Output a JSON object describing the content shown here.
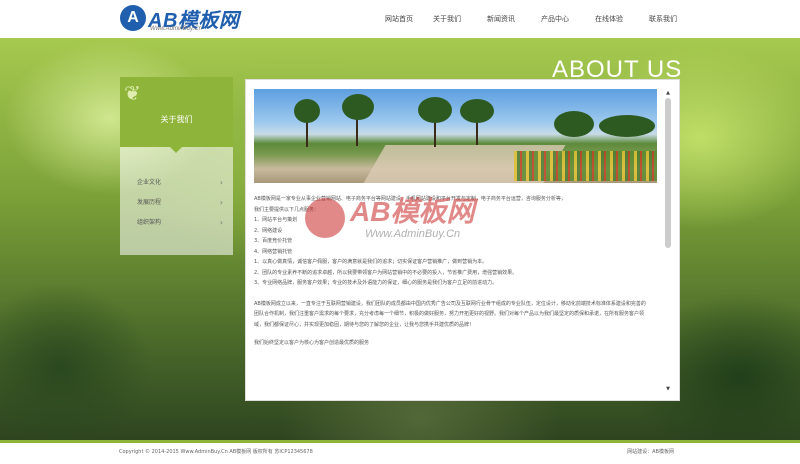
{
  "header": {
    "logo_text": "AB模板网",
    "logo_sub": "Www.AdminBuy.Cn",
    "nav": [
      "网站首页",
      "关于我们",
      "新闻资讯",
      "产品中心",
      "在线体验",
      "联系我们"
    ]
  },
  "banner": {
    "title": "ABOUT US"
  },
  "sidebar": {
    "title": "关于我们",
    "items": [
      {
        "label": "企业文化"
      },
      {
        "label": "发展历程"
      },
      {
        "label": "组织架构"
      }
    ]
  },
  "content": {
    "paragraphs": [
      "AB模板网是一家专业从事企业营销网站、电子商务平台等网站建设、手机网站建设和平台开发与定制，电子商务平台运营，咨询服务分析等，",
      "我们主要提供以下几点服务：",
      "1、网站平台与策划",
      "2、网络建设",
      "3、百度竞价托管",
      "4、网络营销托管",
      "1、以真心做真情，诚信客户佩服，客户的满意就是我们的追求；切实保证客户营销推广，做到营销为本。",
      "2、团队的专业素养不断的追求卓越，所以我要带领客户为网站营销中的不必要的投入，节省推广费用，增强营销效果。",
      "3、专业网络品牌，服务客户效果；专业的技术及外语能力的保证，细心的服务是我们为客户立足的前进动力。"
    ],
    "paragraphs_b": [
      "AB模板网成立以来，一直专注于互联网营销建设，我们团队的成员都由中国内优秀广告公司及互联网行业骨干组成的专业队伍，定位设计，移动化前端技术标准体系建设和完善的团队合作机制，我们注重客户需求的每个要求，充分考虑每一个细节，积极的做好服务，努力开拓更好的视野。我们对每个产品以为我们最坚定的质保和承诺，在所有服务客户领域，我们都保证尽心，并实现更加稳固，期待与您的了解您的企业，让我与您携手共建优质的品牌！"
    ],
    "paragraphs_c": [
      "我们始终坚定以客户为核心为客户创造最优质的服务"
    ]
  },
  "watermark": {
    "text": "AB模板网",
    "sub": "Www.AdminBuy.Cn"
  },
  "footer": {
    "copyright": "Copyright © 2014-2015 Www.AdminBuy.Cn AB模板网  版权所有  苏ICP12345678",
    "right": "网站建设：AB模板网"
  },
  "colors": {
    "accent": "#8fb43a",
    "brand": "#1f5fae"
  }
}
